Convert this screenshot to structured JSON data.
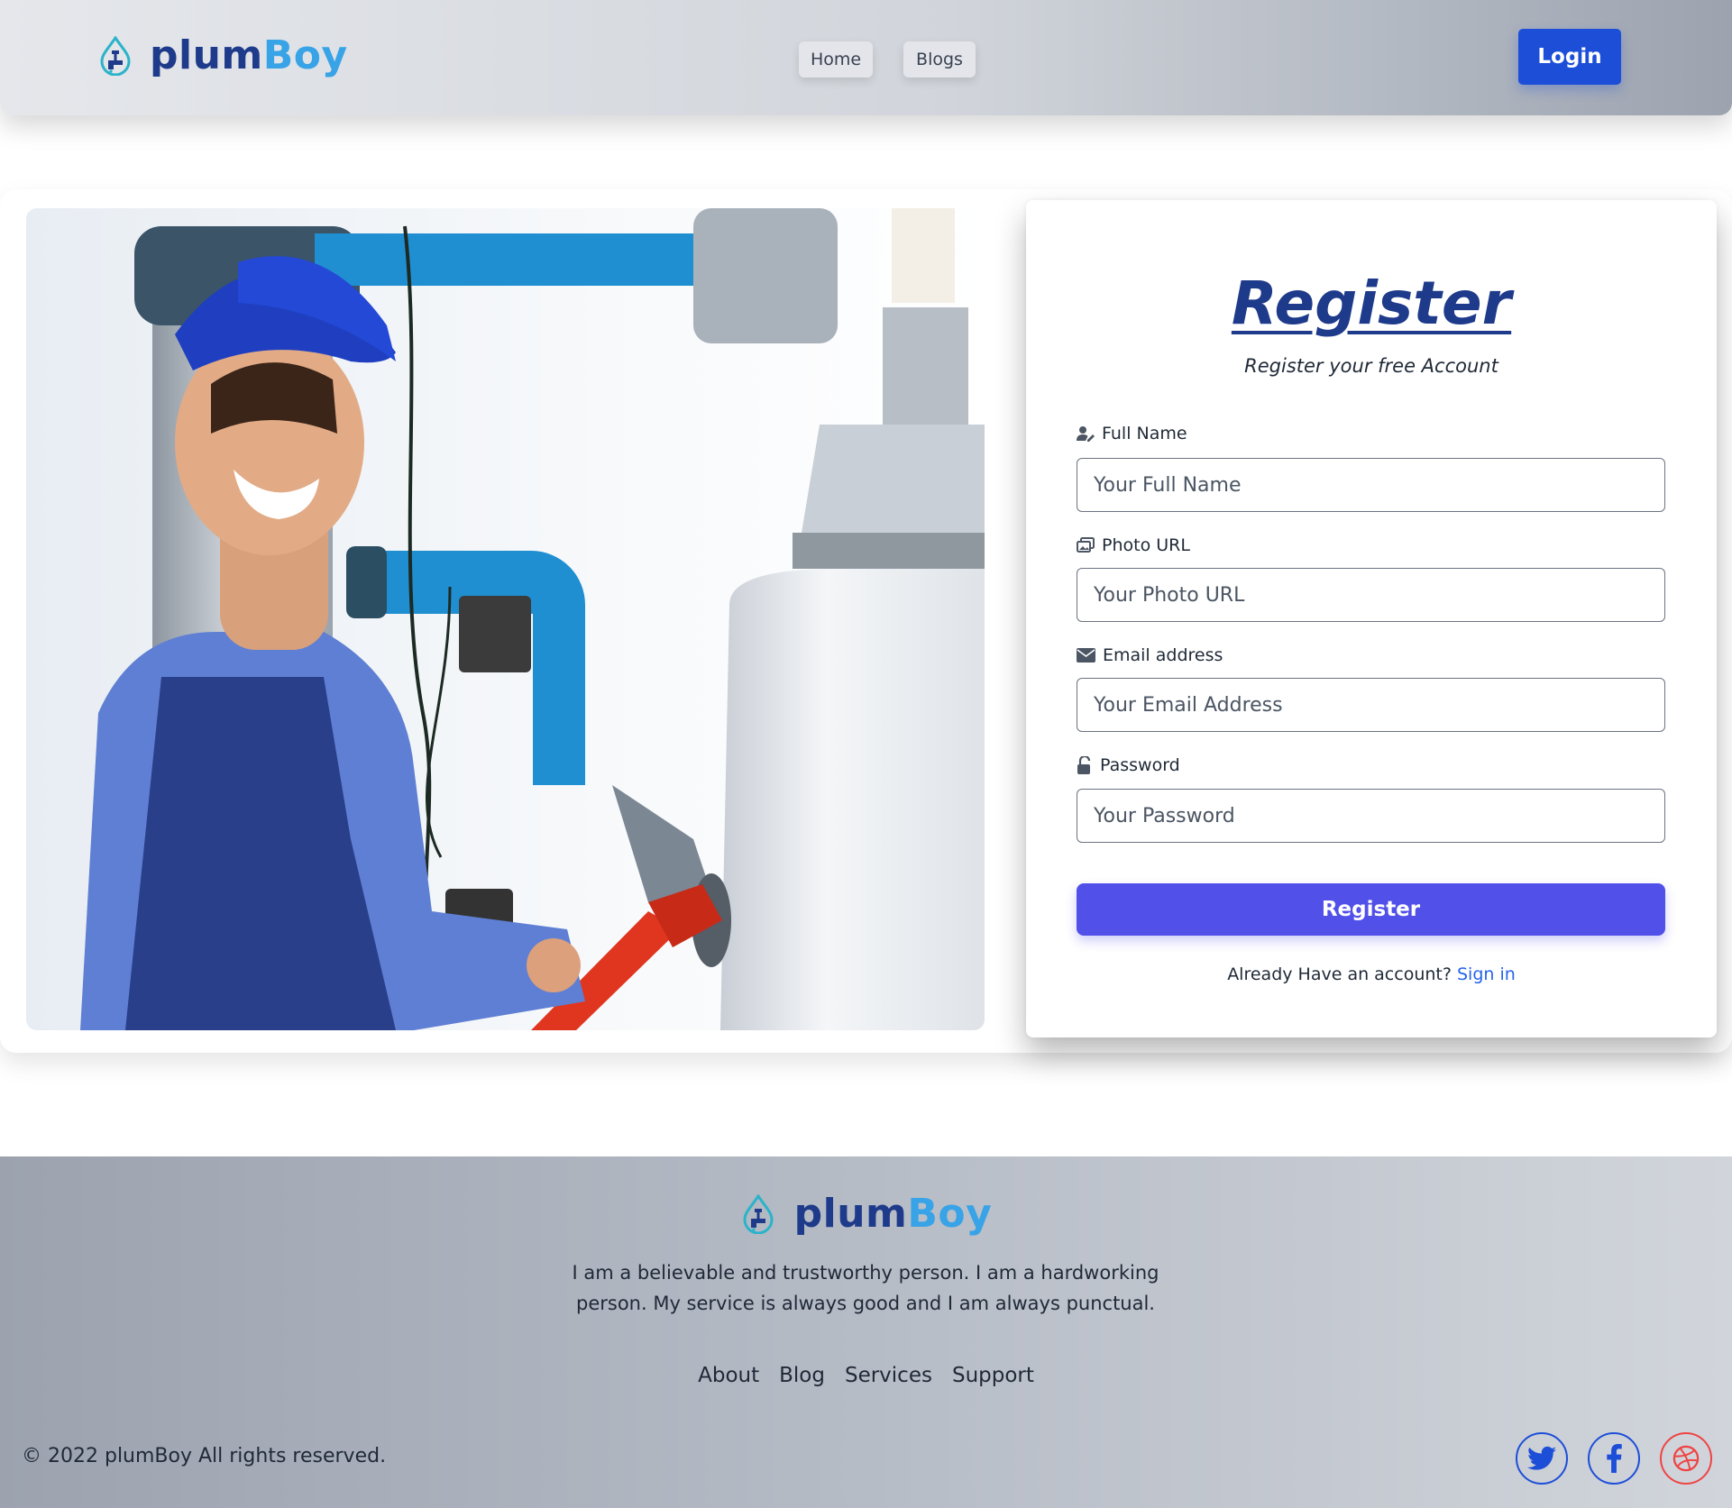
{
  "brand": {
    "part1": "plum",
    "part2": "Boy"
  },
  "nav": {
    "home": "Home",
    "blogs": "Blogs",
    "login": "Login"
  },
  "register": {
    "title": "Register",
    "subtitle": "Register your free Account",
    "fields": [
      {
        "label": "Full Name",
        "placeholder": "Your Full Name",
        "icon": "user-edit-icon"
      },
      {
        "label": "Photo URL",
        "placeholder": "Your Photo URL",
        "icon": "image-icon"
      },
      {
        "label": "Email address",
        "placeholder": "Your Email Address",
        "icon": "envelope-icon"
      },
      {
        "label": "Password",
        "placeholder": "Your Password",
        "icon": "unlock-icon"
      }
    ],
    "button": "Register",
    "signin_prompt": "Already Have an account?",
    "signin_link": "Sign in"
  },
  "footer": {
    "description": "I am a believable and trustworthy person. I am a hardworking person. My service is always good and I am always punctual.",
    "links": [
      "About",
      "Blog",
      "Services",
      "Support"
    ],
    "copyright": "© 2022 plumBoy All rights reserved.",
    "social": [
      "twitter-icon",
      "facebook-icon",
      "dribbble-icon"
    ]
  },
  "colors": {
    "brand_dark": "#1e3a8a",
    "brand_light": "#38a3e6",
    "login_button": "#1d4ed8",
    "register_button": "#5150e8",
    "link": "#2563eb",
    "dribbble": "#ef4444"
  }
}
